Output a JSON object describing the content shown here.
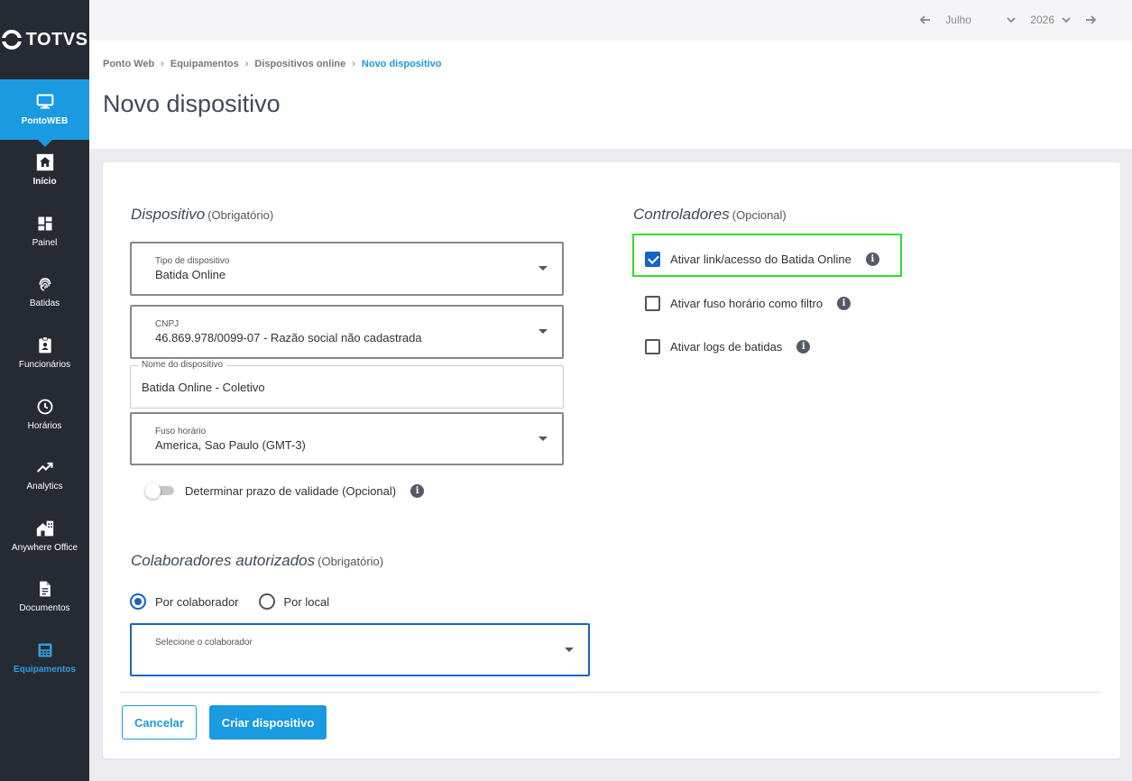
{
  "brand": {
    "logo_text": "TOTVS"
  },
  "sidebar": {
    "app": {
      "label": "PontoWEB",
      "icon": "monitor-icon"
    },
    "items": [
      {
        "label": "Início",
        "icon": "home-icon"
      },
      {
        "label": "Painel",
        "icon": "dashboard-icon"
      },
      {
        "label": "Batidas",
        "icon": "fingerprint-icon"
      },
      {
        "label": "Funcionários",
        "icon": "badge-icon"
      },
      {
        "label": "Horários",
        "icon": "clock-icon"
      },
      {
        "label": "Analytics",
        "icon": "trending-up-icon"
      },
      {
        "label": "Anywhere Office",
        "icon": "home-office-icon"
      },
      {
        "label": "Documentos",
        "icon": "document-icon"
      },
      {
        "label": "Equipamentos",
        "icon": "device-icon"
      }
    ]
  },
  "topbar": {
    "month": "Julho",
    "year": "2026"
  },
  "breadcrumb": [
    "Ponto Web",
    "Equipamentos",
    "Dispositivos online",
    "Novo dispositivo"
  ],
  "page": {
    "title": "Novo dispositivo"
  },
  "dispositivo": {
    "title": "Dispositivo",
    "note": "(Obrigatório)",
    "tipo": {
      "label": "Tipo de dispositivo",
      "value": "Batida Online"
    },
    "cnpj": {
      "label": "CNPJ",
      "value": "46.869.978/0099-07 - Razão social não cadastrada"
    },
    "nome": {
      "label": "Nome do dispositivo",
      "value": "Batida Online - Coletivo"
    },
    "fuso": {
      "label": "Fuso horário",
      "value": "America, Sao Paulo (GMT-3)"
    },
    "validade": {
      "label": "Determinar prazo de validade (Opcional)"
    }
  },
  "controladores": {
    "title": "Controladores",
    "note": "(Opcional)",
    "options": [
      {
        "label": "Ativar link/acesso do Batida Online"
      },
      {
        "label": "Ativar fuso horário como filtro"
      },
      {
        "label": "Ativar logs de batidas"
      }
    ]
  },
  "colaboradores": {
    "title": "Colaboradores autorizados",
    "note": "(Obrigatório)",
    "radio_colaborador": "Por colaborador",
    "radio_local": "Por local",
    "select_label": "Selecione o colaborador"
  },
  "actions": {
    "cancel": "Cancelar",
    "create": "Criar dispositivo"
  },
  "colors": {
    "accent": "#1a9ae0",
    "sidebar": "#262a33",
    "highlight": "#2ee02e",
    "checkbox": "#1565c0"
  }
}
